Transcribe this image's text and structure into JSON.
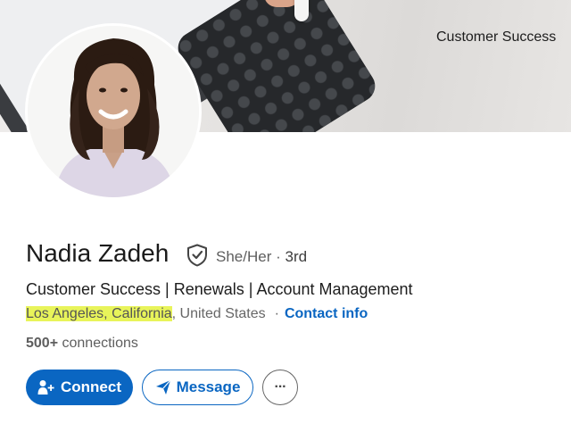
{
  "banner": {
    "text": "Customer Success"
  },
  "profile": {
    "name": "Nadia Zadeh",
    "pronouns": "She/Her",
    "separator": "·",
    "degree": "3rd",
    "headline": "Customer Success | Renewals | Account Management",
    "location_highlighted": "Los Angeles, California",
    "location_rest": ", United States",
    "location_dot": "·",
    "contact_info": "Contact info",
    "connections_count": "500+",
    "connections_label": "connections"
  },
  "actions": {
    "connect_label": "Connect",
    "message_label": "Message",
    "more_label": "···"
  },
  "colors": {
    "accent": "#0a66c2",
    "highlight": "#e8f45a"
  },
  "icons": {
    "verify": "shield-check-icon",
    "connect": "add-person-icon",
    "message": "send-icon",
    "more": "ellipsis-icon"
  }
}
